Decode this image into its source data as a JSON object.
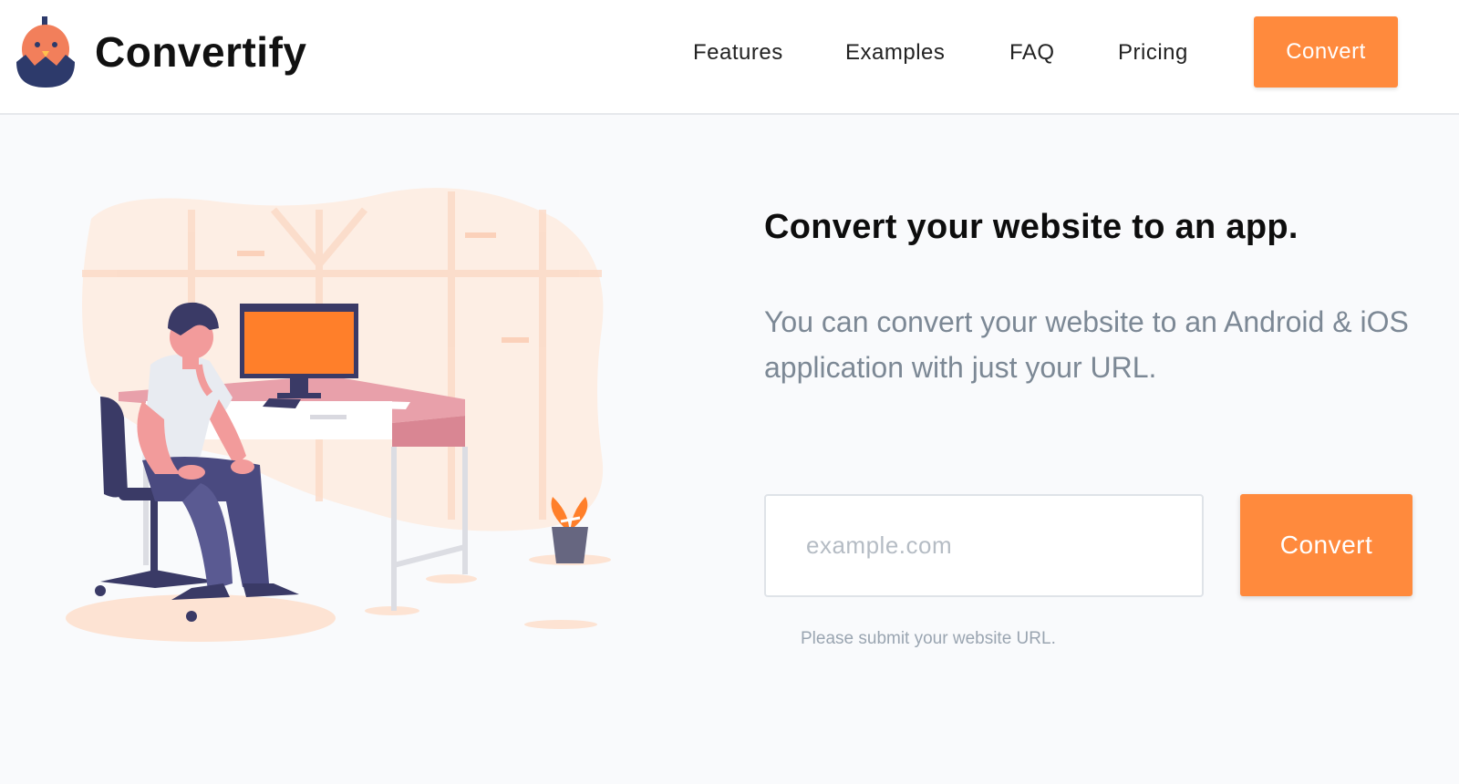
{
  "brand": {
    "name": "Convertify",
    "logo_icon": "chick-in-egg-icon",
    "accent_color": "#ff8a3d"
  },
  "nav": {
    "items": [
      {
        "label": "Features"
      },
      {
        "label": "Examples"
      },
      {
        "label": "FAQ"
      },
      {
        "label": "Pricing"
      }
    ],
    "cta_label": "Convert"
  },
  "hero": {
    "illustration_icon": "person-at-desk-illustration",
    "headline": "Convert your website to an app.",
    "subtext": "You can convert your website to an Android & iOS application with just your URL.",
    "url_input": {
      "placeholder": "example.com",
      "value": ""
    },
    "submit_label": "Convert",
    "hint": "Please submit your website URL."
  }
}
